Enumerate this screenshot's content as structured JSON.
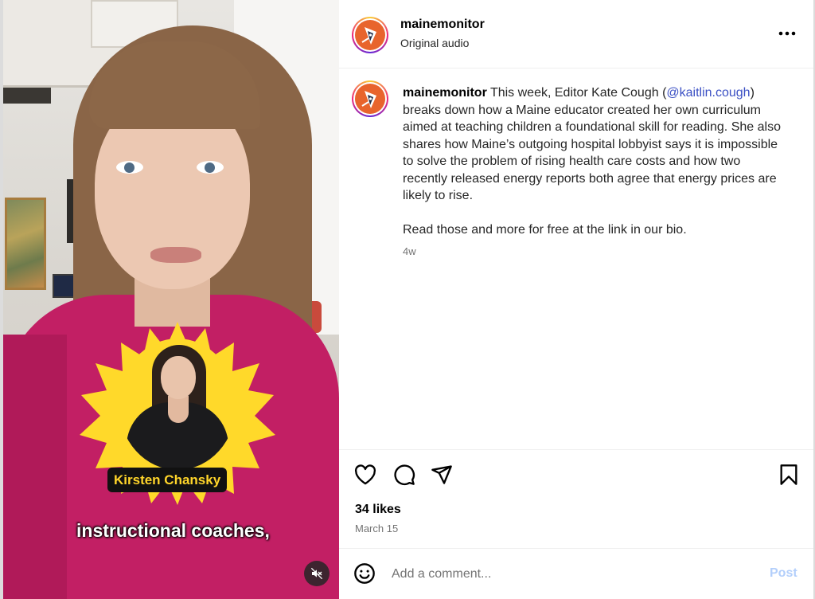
{
  "post": {
    "username": "mainemonitor",
    "audio_label": "Original audio",
    "more_icon": "more-horizontal-icon",
    "caption": {
      "username": "mainemonitor",
      "text_before_mention": " This week, Editor Kate Cough (",
      "mention": "@kaitlin.cough",
      "text_after_mention": ") breaks down how a Maine educator created her own curriculum aimed at teaching children a foundational skill for reading. She also shares how Maine’s outgoing hospital lobbyist says it is impossible to solve the problem of rising health care costs and how two recently released energy reports both agree that energy prices are likely to rise.",
      "paragraph_2": "Read those and more for free at the link in our bio."
    },
    "time_ago": "4w",
    "likes": "34 likes",
    "date": "March 15",
    "actions": {
      "like_icon": "heart-icon",
      "comment_icon": "comment-icon",
      "share_icon": "send-icon",
      "save_icon": "bookmark-icon"
    },
    "composer": {
      "emoji_icon": "emoji-icon",
      "placeholder": "Add a comment...",
      "post_label": "Post"
    }
  },
  "video": {
    "name_tag": "Kirsten Chansky",
    "subtitle": "instructional coaches,",
    "mute_icon": "muted-speaker-icon"
  },
  "colors": {
    "mention": "#3b50c4",
    "post_button_disabled": "#b3cffb",
    "logo_orange": "#e8642d",
    "sunburst_yellow": "#ffd92a",
    "sweater_pink": "#c21f64"
  }
}
